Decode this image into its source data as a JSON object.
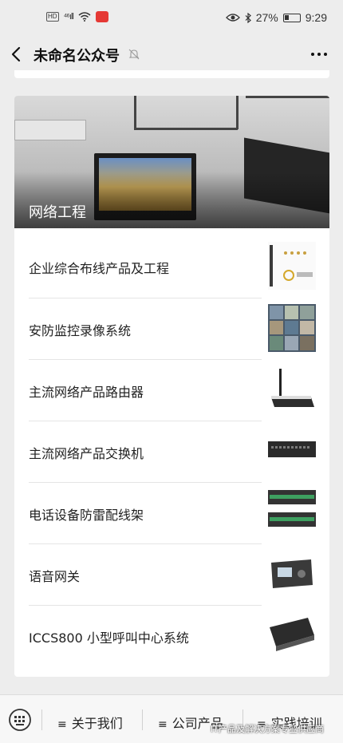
{
  "status_bar": {
    "hd": "HD",
    "signal": "⁴⁶ıll",
    "battery_percent": "27%",
    "battery_level": 0.27,
    "time": "9:29"
  },
  "nav": {
    "title": "未命名公众号"
  },
  "card": {
    "cover_title": "网络工程",
    "items": [
      {
        "label": "企业综合布线产品及工程"
      },
      {
        "label": "安防监控录像系统"
      },
      {
        "label": "主流网络产品路由器"
      },
      {
        "label": "主流网络产品交换机"
      },
      {
        "label": "电话设备防雷配线架"
      },
      {
        "label": "语音网关"
      },
      {
        "label": "ICCS800 小型呼叫中心系统"
      }
    ]
  },
  "bottom_menu": {
    "items": [
      {
        "label": "关于我们"
      },
      {
        "label": "公司产品"
      },
      {
        "label": "实践培训"
      }
    ],
    "watermark": "IT产品及解决方案专业供应商"
  }
}
